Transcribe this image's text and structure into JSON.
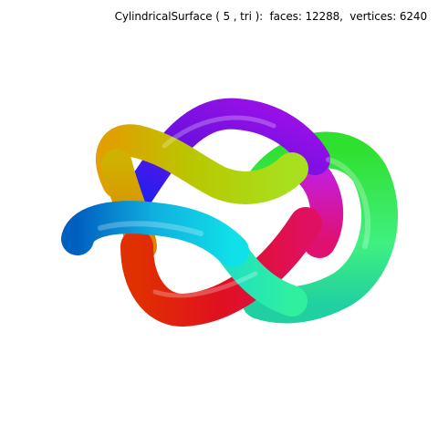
{
  "caption": "CylindricalSurface ( 5 , tri ):  faces: 12288,  vertices: 6240",
  "background": "#ffffff",
  "knot": {
    "colors": {
      "orange": "#e0a000",
      "yellow_green": "#a8d000",
      "green": "#30e030",
      "magenta": "#c020e0",
      "purple": "#7010e0",
      "blue": "#2020f0",
      "cyan": "#10d0e0",
      "teal_green": "#20e0a0",
      "red": "#e01030",
      "red_orange": "#e03000"
    }
  }
}
